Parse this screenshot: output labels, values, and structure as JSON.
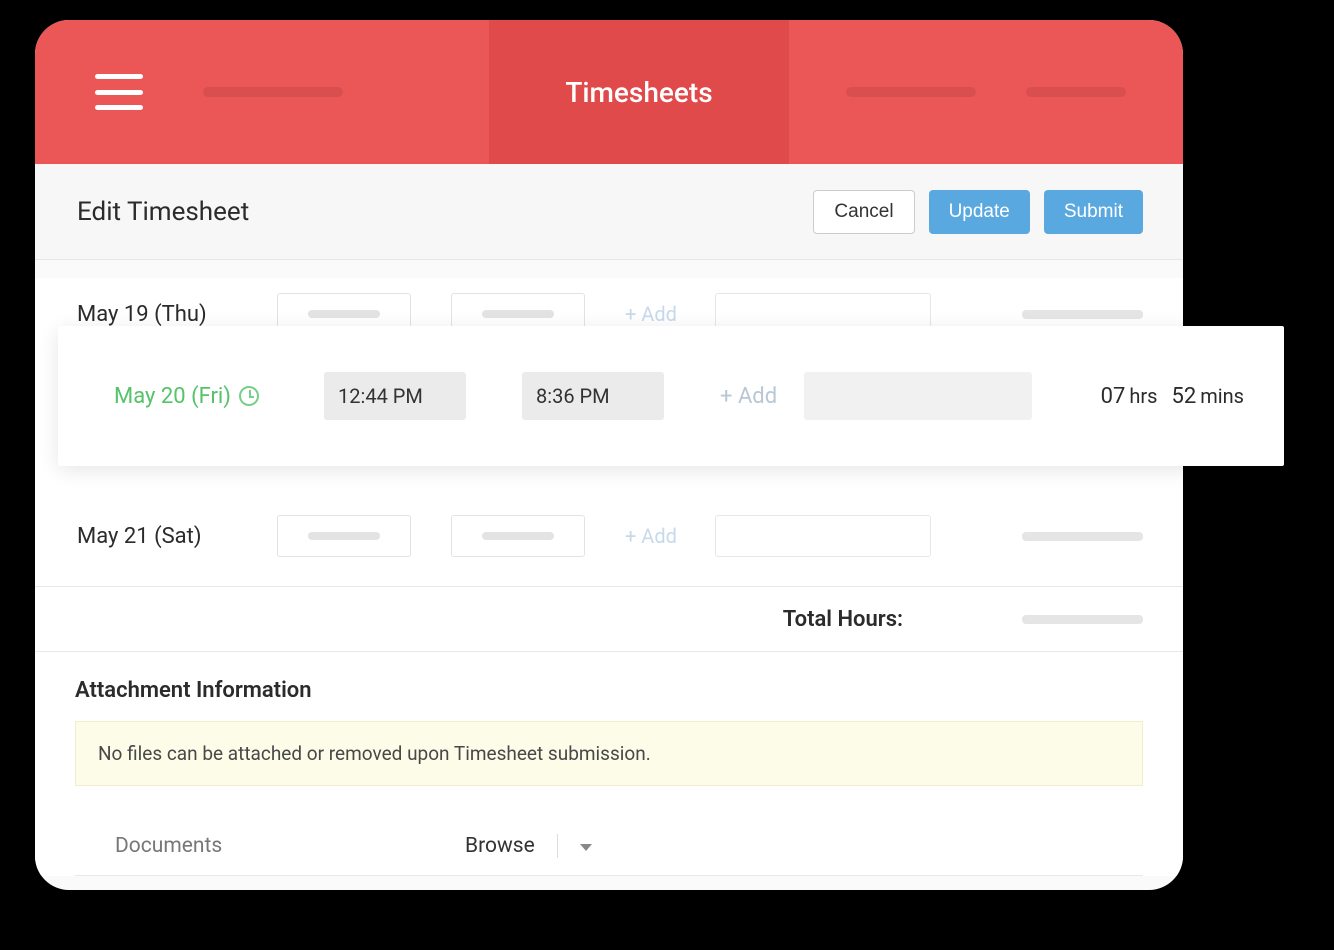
{
  "header": {
    "title": "Timesheets"
  },
  "subheader": {
    "title": "Edit Timesheet",
    "buttons": {
      "cancel": "Cancel",
      "update": "Update",
      "submit": "Submit"
    }
  },
  "rows": {
    "r0": {
      "label": "May 19 (Thu)",
      "add": "+ Add"
    },
    "r1": {
      "label": "May 20 (Fri)",
      "start": "12:44 PM",
      "end": "8:36 PM",
      "add": "+ Add",
      "hrs_num": "07",
      "hrs_unit": "hrs",
      "mins_num": "52",
      "mins_unit": "mins"
    },
    "r2": {
      "label": "May 21 (Sat)",
      "add": "+ Add"
    }
  },
  "totals": {
    "label": "Total Hours:"
  },
  "attachments": {
    "heading": "Attachment Information",
    "banner": "No files can be attached or removed upon Timesheet submission.",
    "documents_label": "Documents",
    "browse_label": "Browse"
  }
}
